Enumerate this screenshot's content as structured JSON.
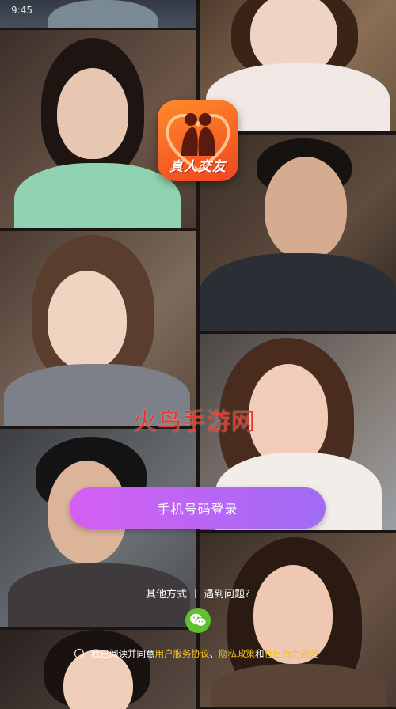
{
  "status_bar": {
    "time": "9:45"
  },
  "app": {
    "logo_text": "真人交友",
    "watermark": "火鸟手游网"
  },
  "login": {
    "phone_login_label": "手机号码登录"
  },
  "alt": {
    "other_methods_label": "其他方式",
    "problem_label": "遇到问题?"
  },
  "agreement": {
    "prefix": "我已阅读并同意",
    "user_agreement": "用户服务协议",
    "sep1": "、",
    "privacy_policy": "隐私政策",
    "and": "和",
    "community_rules": "社区行为规范"
  },
  "colors": {
    "accent_gradient_start": "#d55ff3",
    "accent_gradient_end": "#a06cf4",
    "link": "#f2c21b",
    "wechat": "#5fc12d"
  }
}
